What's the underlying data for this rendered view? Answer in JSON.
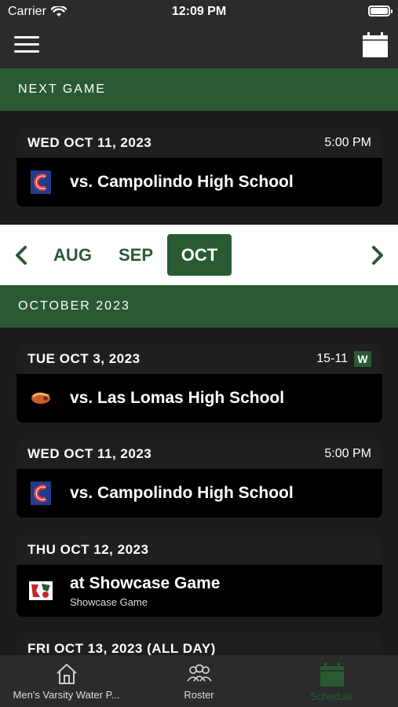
{
  "status": {
    "carrier": "Carrier",
    "time": "12:09 PM"
  },
  "next_game": {
    "header": "NEXT GAME",
    "date": "WED OCT 11, 2023",
    "time": "5:00 PM",
    "opponent": "vs. Campolindo High School",
    "logo_icon": "campolindo-c-logo"
  },
  "months": {
    "items": [
      "AUG",
      "SEP",
      "OCT"
    ],
    "selected": "OCT"
  },
  "month_section": {
    "header": "OCTOBER 2023"
  },
  "games": [
    {
      "date": "TUE OCT 3, 2023",
      "score": "15-11",
      "result": "W",
      "opponent": "vs. Las Lomas High School",
      "logo_icon": "las-lomas-logo"
    },
    {
      "date": "WED OCT 11, 2023",
      "time": "5:00 PM",
      "opponent": "vs. Campolindo High School",
      "logo_icon": "campolindo-c-logo"
    },
    {
      "date": "THU OCT 12, 2023",
      "opponent": "at Showcase Game",
      "subtitle": "Showcase Game",
      "logo_icon": "showcase-logo"
    },
    {
      "date": "FRI OCT 13, 2023 (ALL DAY)"
    }
  ],
  "tabs": [
    {
      "label": "Men's Varsity Water P...",
      "icon": "home-icon"
    },
    {
      "label": "Roster",
      "icon": "roster-icon"
    },
    {
      "label": "Schedule",
      "icon": "schedule-icon",
      "active": true
    }
  ],
  "colors": {
    "accent": "#2a5a33",
    "background": "#1c1c1e",
    "card": "#000000",
    "bar": "#2b2b2b"
  }
}
